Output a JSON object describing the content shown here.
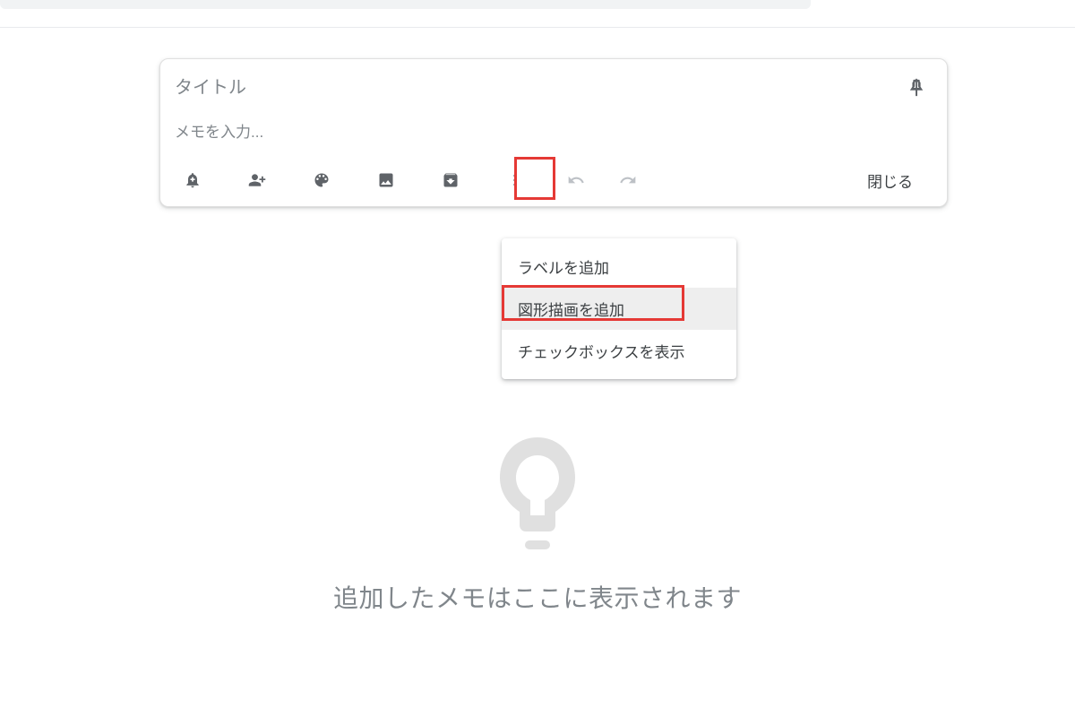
{
  "note": {
    "title_placeholder": "タイトル",
    "body_placeholder": "メモを入力...",
    "close_label": "閉じる"
  },
  "menu": {
    "add_label": "ラベルを追加",
    "add_drawing": "図形描画を追加",
    "show_checkboxes": "チェックボックスを表示"
  },
  "empty": {
    "message": "追加したメモはここに表示されます"
  }
}
